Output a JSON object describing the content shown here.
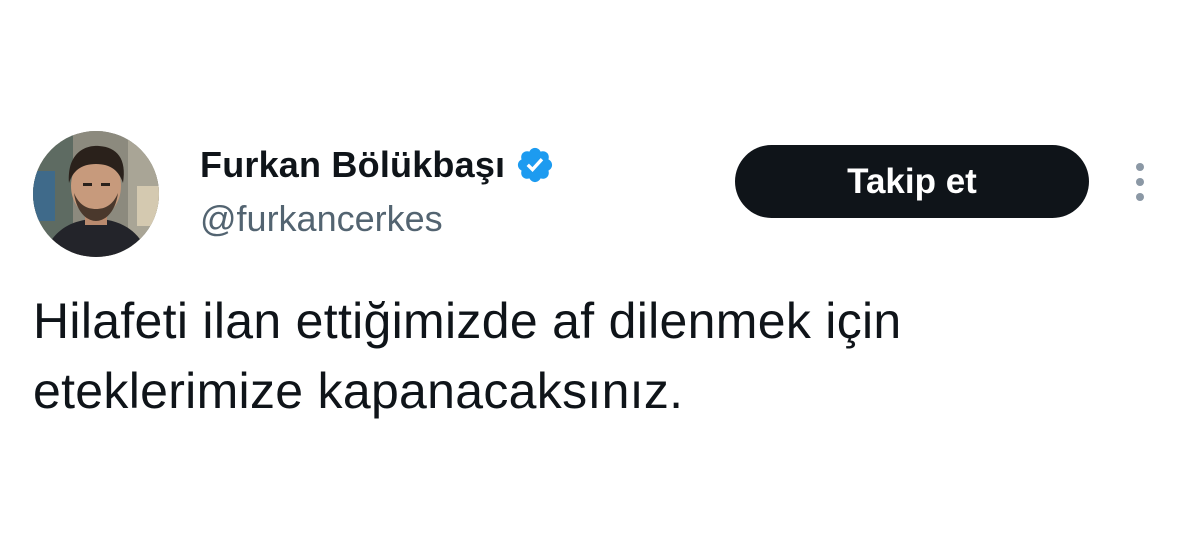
{
  "author": {
    "display_name": "Furkan Bölükbaşı",
    "handle": "@furkancerkes",
    "verified_icon": "verified-badge-icon",
    "verified_color": "#1d9bf0"
  },
  "actions": {
    "follow_label": "Takip et",
    "more_icon": "more-vertical-icon"
  },
  "tweet": {
    "text": "Hilafeti ilan ettiğimizde af dilenmek için eteklerimize kapanacaksınız."
  },
  "colors": {
    "text_primary": "#0f1419",
    "text_secondary": "#536471",
    "button_bg": "#0f1419",
    "button_text": "#ffffff"
  }
}
